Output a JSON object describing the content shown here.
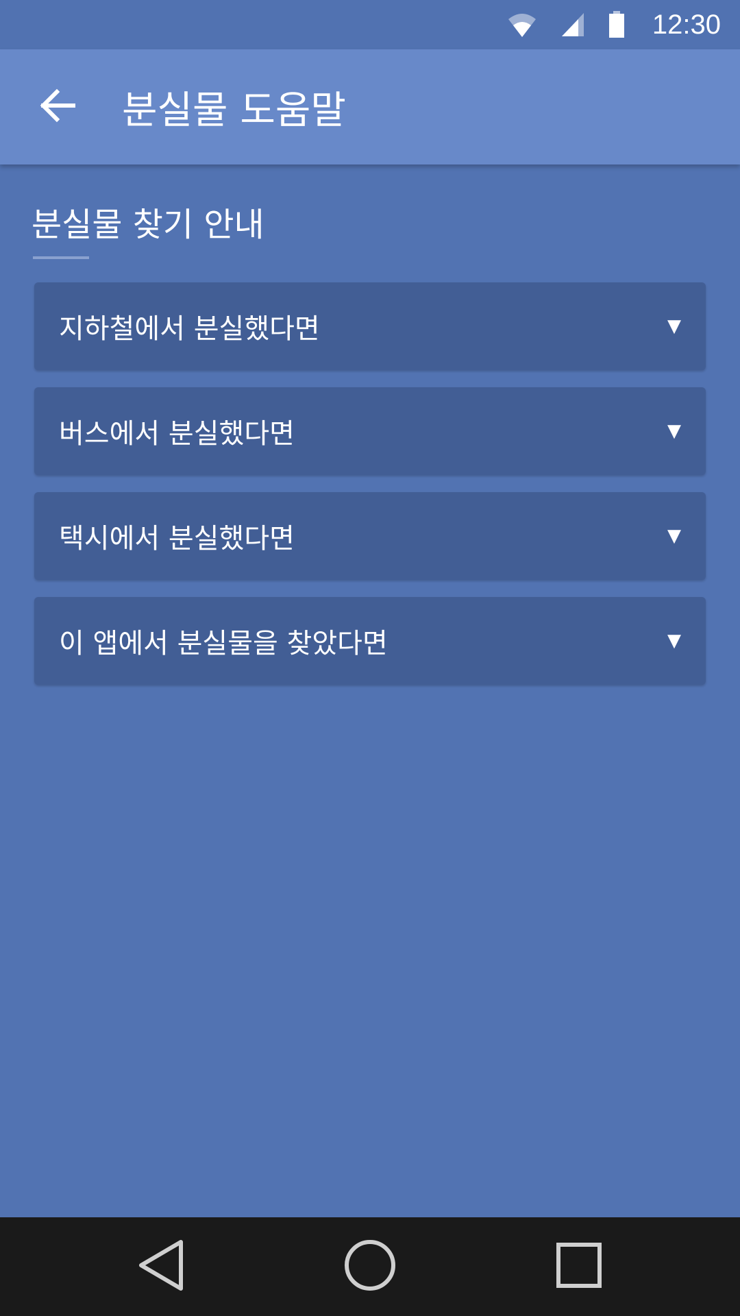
{
  "status_bar": {
    "time": "12:30",
    "icons": [
      "wifi-icon",
      "cell-signal-icon",
      "battery-icon"
    ]
  },
  "app_bar": {
    "back_icon": "arrow-left-icon",
    "title": "분실물 도움말"
  },
  "section": {
    "title": "분실물 찾기 안내"
  },
  "accordion": {
    "items": [
      {
        "label": "지하철에서 분실했다면",
        "arrow": "▼"
      },
      {
        "label": "버스에서 분실했다면",
        "arrow": "▼"
      },
      {
        "label": "택시에서 분실했다면",
        "arrow": "▼"
      },
      {
        "label": "이 앱에서 분실물을 찾았다면",
        "arrow": "▼"
      }
    ]
  },
  "nav_bar": {
    "icons": [
      "back-triangle-icon",
      "home-circle-icon",
      "recents-square-icon"
    ]
  },
  "colors": {
    "background": "#5273b2",
    "app_bar": "#6889c9",
    "card": "#425e95",
    "nav_bar": "#1a1a1a"
  }
}
